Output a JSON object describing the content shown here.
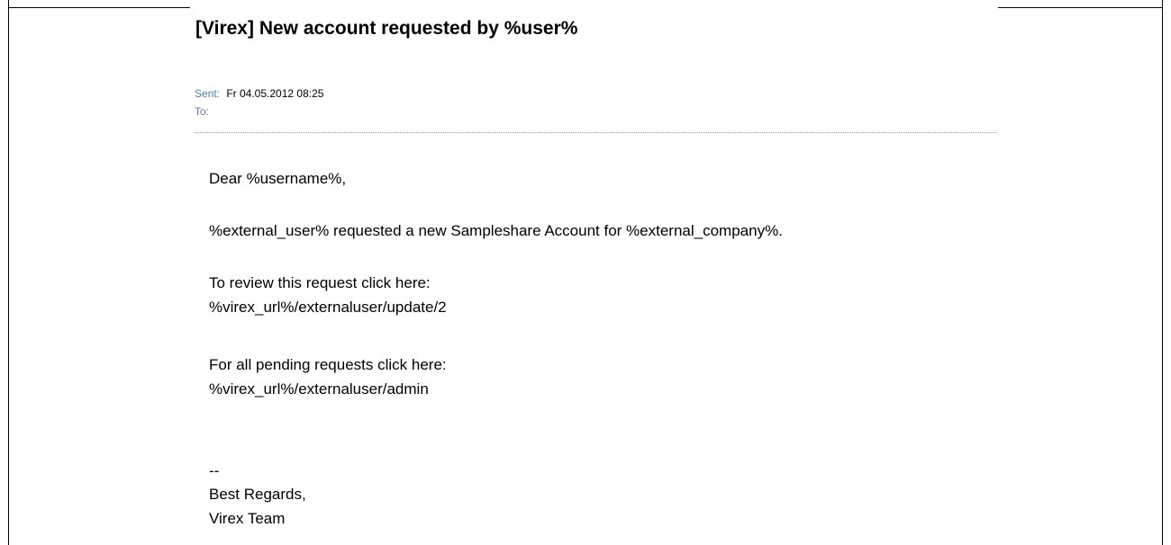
{
  "email": {
    "subject": "[Virex] New account requested by %user%",
    "sent_label": "Sent:",
    "sent_value": "Fr 04.05.2012 08:25",
    "to_label": "To:",
    "to_value": "",
    "body": {
      "greeting": "Dear %username%,",
      "request_line": "%external_user% requested a new Sampleshare Account for %external_company%.",
      "review_prompt": "To review this request click here:",
      "review_url": "%virex_url%/externaluser/update/2",
      "pending_prompt": "For all pending requests click here:",
      "pending_url": "%virex_url%/externaluser/admin",
      "signature_dashes": "--",
      "signature_regards": "Best Regards,",
      "signature_team": "Virex Team"
    }
  },
  "colors": {
    "header_label": "#4f81bd",
    "text": "#000000",
    "divider": "#9a9a9a"
  }
}
